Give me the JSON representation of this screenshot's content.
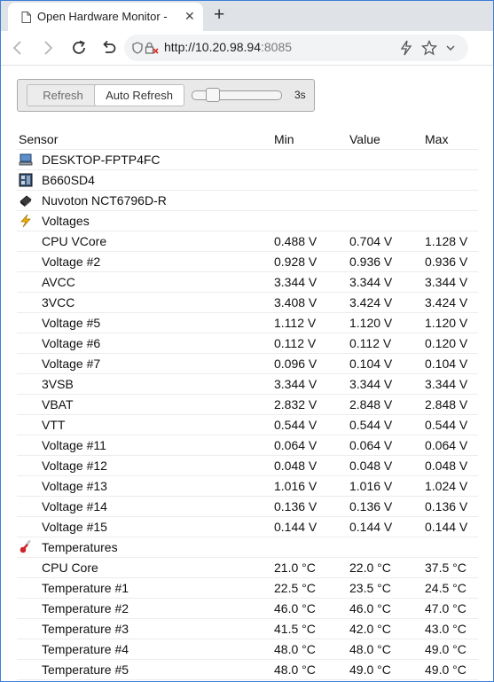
{
  "browser": {
    "tab_title": "Open Hardware Monitor -",
    "url_host": "http://10.20.98.94",
    "url_port": ":8085"
  },
  "toolbar": {
    "refresh_label": "Refresh",
    "auto_refresh_label": "Auto Refresh",
    "interval_label": "3s"
  },
  "table": {
    "headers": {
      "sensor": "Sensor",
      "min": "Min",
      "value": "Value",
      "max": "Max"
    },
    "nodes": {
      "computer": "DESKTOP-FPTP4FC",
      "mainboard": "B660SD4",
      "chip": "Nuvoton NCT6796D-R",
      "voltages": "Voltages",
      "temperatures": "Temperatures"
    },
    "voltage_rows": [
      {
        "name": "CPU VCore",
        "min": "0.488 V",
        "value": "0.704 V",
        "max": "1.128 V"
      },
      {
        "name": "Voltage #2",
        "min": "0.928 V",
        "value": "0.936 V",
        "max": "0.936 V"
      },
      {
        "name": "AVCC",
        "min": "3.344 V",
        "value": "3.344 V",
        "max": "3.344 V"
      },
      {
        "name": "3VCC",
        "min": "3.408 V",
        "value": "3.424 V",
        "max": "3.424 V"
      },
      {
        "name": "Voltage #5",
        "min": "1.112 V",
        "value": "1.120 V",
        "max": "1.120 V"
      },
      {
        "name": "Voltage #6",
        "min": "0.112 V",
        "value": "0.112 V",
        "max": "0.120 V"
      },
      {
        "name": "Voltage #7",
        "min": "0.096 V",
        "value": "0.104 V",
        "max": "0.104 V"
      },
      {
        "name": "3VSB",
        "min": "3.344 V",
        "value": "3.344 V",
        "max": "3.344 V"
      },
      {
        "name": "VBAT",
        "min": "2.832 V",
        "value": "2.848 V",
        "max": "2.848 V"
      },
      {
        "name": "VTT",
        "min": "0.544 V",
        "value": "0.544 V",
        "max": "0.544 V"
      },
      {
        "name": "Voltage #11",
        "min": "0.064 V",
        "value": "0.064 V",
        "max": "0.064 V"
      },
      {
        "name": "Voltage #12",
        "min": "0.048 V",
        "value": "0.048 V",
        "max": "0.048 V"
      },
      {
        "name": "Voltage #13",
        "min": "1.016 V",
        "value": "1.016 V",
        "max": "1.024 V"
      },
      {
        "name": "Voltage #14",
        "min": "0.136 V",
        "value": "0.136 V",
        "max": "0.136 V"
      },
      {
        "name": "Voltage #15",
        "min": "0.144 V",
        "value": "0.144 V",
        "max": "0.144 V"
      }
    ],
    "temperature_rows": [
      {
        "name": "CPU Core",
        "min": "21.0 °C",
        "value": "22.0 °C",
        "max": "37.5 °C"
      },
      {
        "name": "Temperature #1",
        "min": "22.5 °C",
        "value": "23.5 °C",
        "max": "24.5 °C"
      },
      {
        "name": "Temperature #2",
        "min": "46.0 °C",
        "value": "46.0 °C",
        "max": "47.0 °C"
      },
      {
        "name": "Temperature #3",
        "min": "41.5 °C",
        "value": "42.0 °C",
        "max": "43.0 °C"
      },
      {
        "name": "Temperature #4",
        "min": "48.0 °C",
        "value": "48.0 °C",
        "max": "49.0 °C"
      },
      {
        "name": "Temperature #5",
        "min": "48.0 °C",
        "value": "49.0 °C",
        "max": "49.0 °C"
      }
    ]
  },
  "icons": {
    "favicon": "page-icon",
    "back": "back-arrow-icon",
    "forward": "forward-arrow-icon",
    "reload": "reload-icon",
    "undo": "undo-icon",
    "security": "not-secure-icon",
    "bolt": "lightning-icon",
    "star": "star-icon",
    "dropdown": "chevron-down-icon",
    "computer": "computer-icon",
    "mainboard": "mainboard-icon",
    "chip": "chip-icon",
    "voltages": "lightning-icon",
    "temperatures": "thermometer-icon"
  },
  "colors": {
    "accent": "#3b7fd6",
    "voltage_icon": "#f0b400",
    "thermometer": "#d2232a"
  }
}
